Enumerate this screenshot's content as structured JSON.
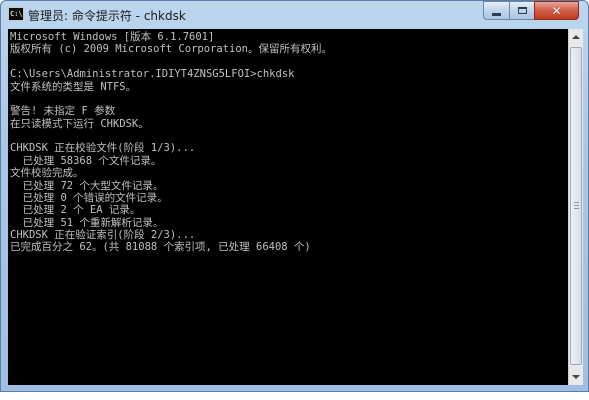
{
  "window": {
    "title": "管理员: 命令提示符 - chkdsk",
    "icon": "cmd-prompt-icon",
    "icon_text": "C:\\.",
    "controls": {
      "minimize": "minimize-icon",
      "maximize": "maximize-icon",
      "close": "close-icon",
      "close_glyph": "✕"
    }
  },
  "console": {
    "lines": [
      "Microsoft Windows [版本 6.1.7601]",
      "版权所有 (c) 2009 Microsoft Corporation。保留所有权利。",
      "",
      "C:\\Users\\Administrator.IDIYT4ZNSG5LFOI>chkdsk",
      "文件系统的类型是 NTFS。",
      "",
      "警告! 未指定 F 参数",
      "在只读模式下运行 CHKDSK。",
      "",
      "CHKDSK 正在校验文件(阶段 1/3)...",
      "  已处理 58368 个文件记录。",
      "文件校验完成。",
      "  已处理 72 个大型文件记录。",
      "  已处理 0 个错误的文件记录。",
      "  已处理 2 个 EA 记录。",
      "  已处理 51 个重新解析记录。",
      "CHKDSK 正在验证索引(阶段 2/3)...",
      "已完成百分之 62。(共 81088 个索引项, 已处理 66408 个)"
    ],
    "colors": {
      "background": "#000000",
      "text": "#c0c0c0"
    }
  },
  "scrollbar": {
    "up_icon": "scroll-up-arrow-icon",
    "down_icon": "scroll-down-arrow-icon"
  }
}
